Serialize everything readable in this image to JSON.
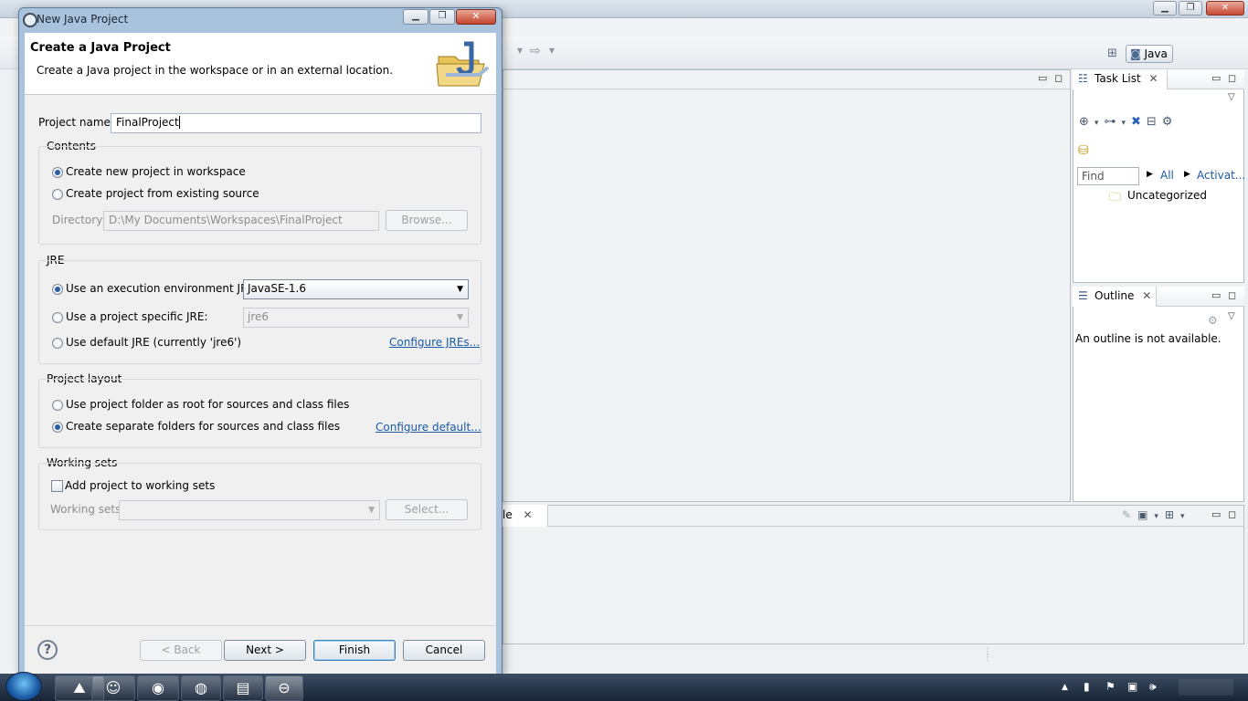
{
  "dialog": {
    "title": "New Java Project",
    "header_title": "Create a Java Project",
    "header_desc": "Create a Java project in the workspace or in an external location.",
    "project_name_label": "Project name:",
    "project_name_value": "FinalProject",
    "contents": {
      "legend": "Contents",
      "opt_new": "Create new project in workspace",
      "opt_existing": "Create project from existing source",
      "directory_label": "Directory:",
      "directory_value": "D:\\My Documents\\Workspaces\\FinalProject",
      "browse": "Browse..."
    },
    "jre": {
      "legend": "JRE",
      "opt_env": "Use an execution environment JRE:",
      "env_value": "JavaSE-1.6",
      "opt_specific": "Use a project specific JRE:",
      "specific_value": "jre6",
      "opt_default": "Use default JRE (currently 'jre6')",
      "configure_link": "Configure JREs..."
    },
    "layout": {
      "legend": "Project layout",
      "opt_root": "Use project folder as root for sources and class files",
      "opt_separate": "Create separate folders for sources and class files",
      "configure_link": "Configure default..."
    },
    "working_sets": {
      "legend": "Working sets",
      "add_label": "Add project to working sets",
      "ws_label": "Working sets:",
      "select": "Select..."
    },
    "buttons": {
      "back": "< Back",
      "next": "Next >",
      "finish": "Finish",
      "cancel": "Cancel"
    }
  },
  "eclipse": {
    "perspective": "Java",
    "task_list": {
      "tab": "Task List",
      "find_placeholder": "Find",
      "all": "All",
      "activate": "Activat...",
      "category": "Uncategorized"
    },
    "outline": {
      "tab": "Outline",
      "message": "An outline is not available."
    },
    "bottom_tab": "le"
  },
  "colors": {
    "link": "#1a5aa8",
    "dialog_frame": "#a9c3dd",
    "taskbar": "#182436"
  }
}
